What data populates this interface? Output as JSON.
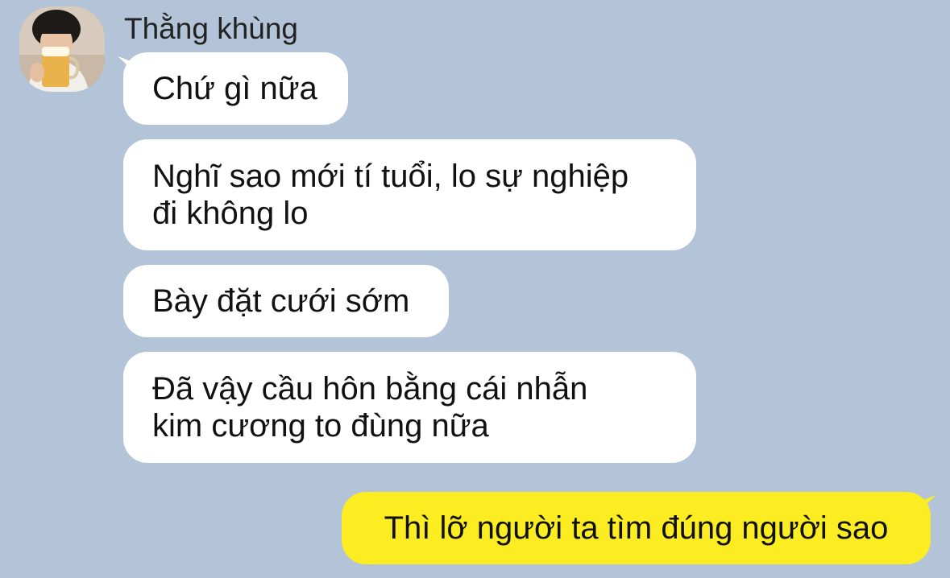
{
  "conversation": {
    "contact": {
      "name": "Thằng khùng",
      "avatar_icon": "profile-photo"
    },
    "incoming_messages": [
      {
        "lines": [
          "Chứ gì nữa"
        ]
      },
      {
        "lines": [
          "Nghĩ sao mới tí tuổi, lo sự nghiệp",
          "đi không lo"
        ]
      },
      {
        "lines": [
          "Bày đặt cưới sớm"
        ]
      },
      {
        "lines": [
          "Đã vậy cầu hôn bằng cái nhẫn",
          "kim cương to đùng nữa"
        ]
      }
    ],
    "outgoing_messages": [
      {
        "lines": [
          "Thì lỡ người ta tìm đúng người sao"
        ]
      }
    ]
  },
  "colors": {
    "background": "#b3c4d8",
    "incoming_bubble": "#ffffff",
    "outgoing_bubble": "#fcec22"
  }
}
